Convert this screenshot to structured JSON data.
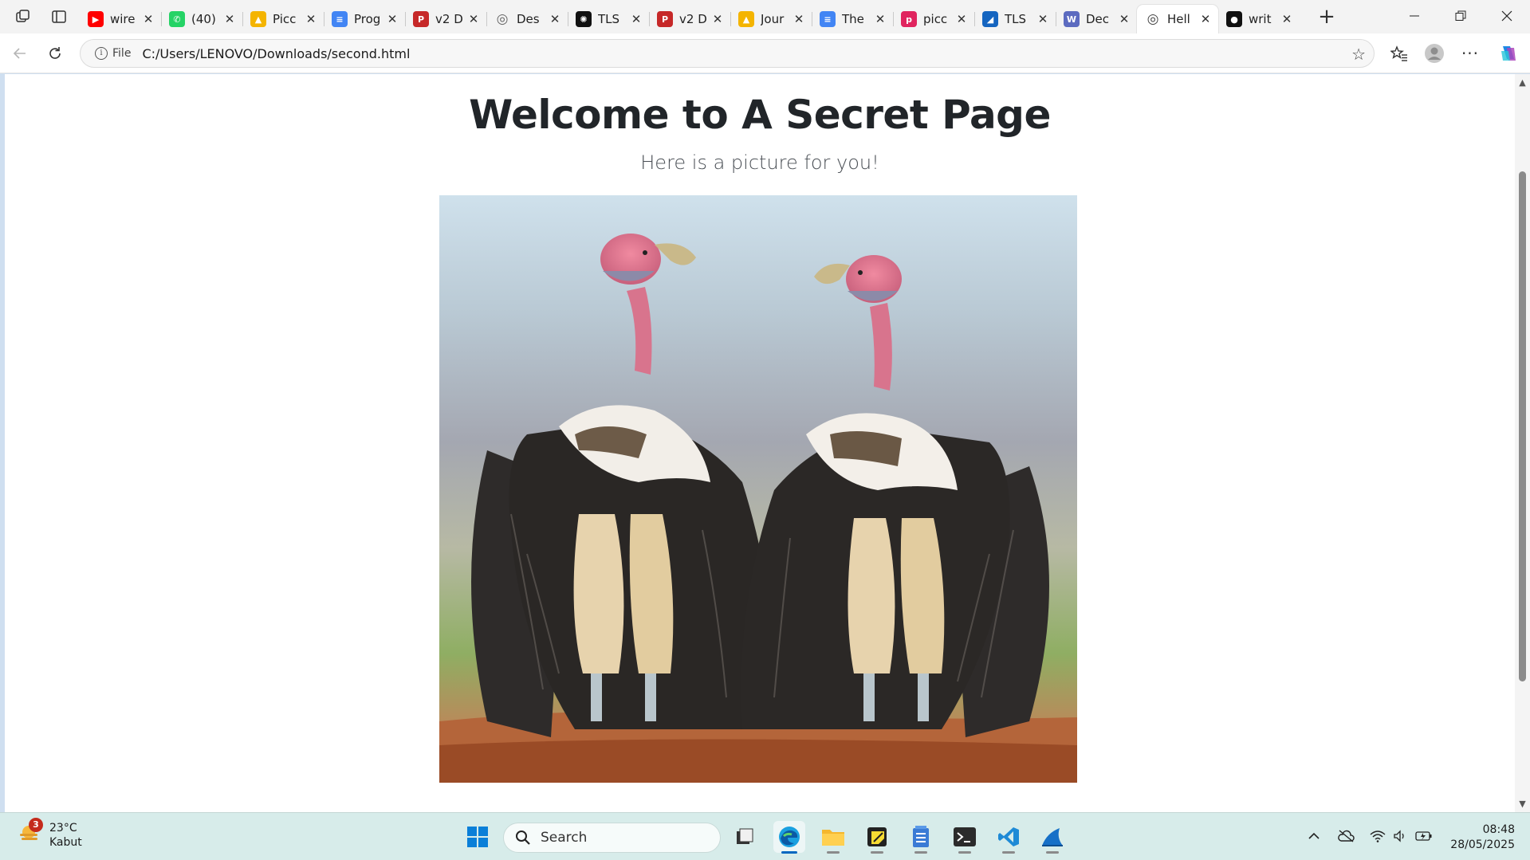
{
  "browser": {
    "tabs": [
      {
        "title": "wire",
        "icon": "youtube-icon",
        "color": "#ff0000",
        "active": false
      },
      {
        "title": "(40)",
        "icon": "whatsapp-icon",
        "color": "#25d366",
        "active": false
      },
      {
        "title": "Picc",
        "icon": "google-drive-icon",
        "color": "#f4b400",
        "active": false
      },
      {
        "title": "Prog",
        "icon": "google-docs-icon",
        "color": "#4285f4",
        "active": false
      },
      {
        "title": "v2 D",
        "icon": "pdf-icon",
        "color": "#c62828",
        "active": false
      },
      {
        "title": "Des",
        "icon": "globe-icon",
        "color": "#666666",
        "active": false
      },
      {
        "title": "TLS",
        "icon": "openai-icon",
        "color": "#111111",
        "active": false
      },
      {
        "title": "v2 D",
        "icon": "pdf-icon",
        "color": "#c62828",
        "active": false
      },
      {
        "title": "Jour",
        "icon": "google-drive-icon",
        "color": "#f4b400",
        "active": false
      },
      {
        "title": "The",
        "icon": "google-docs-icon",
        "color": "#4285f4",
        "active": false
      },
      {
        "title": "picc",
        "icon": "picsart-icon",
        "color": "#e0245e",
        "active": false
      },
      {
        "title": "TLS",
        "icon": "wireshark-icon",
        "color": "#1565c0",
        "active": false
      },
      {
        "title": "Dec",
        "icon": "wordpress-icon",
        "color": "#5c6bc0",
        "active": false
      },
      {
        "title": "Hell",
        "icon": "globe-icon",
        "color": "#444444",
        "active": true
      },
      {
        "title": "writ",
        "icon": "github-icon",
        "color": "#111111",
        "active": false
      }
    ],
    "address": {
      "scheme_label": "File",
      "url": "C:/Users/LENOVO/Downloads/second.html"
    }
  },
  "page": {
    "title": "Welcome to A Secret Page",
    "subtitle": "Here is a picture for you!",
    "image_subject": "two lappet-faced vultures"
  },
  "taskbar": {
    "weather": {
      "temp": "23°C",
      "condition": "Kabut",
      "badge": "3"
    },
    "search_label": "Search",
    "apps": [
      "task-view-icon",
      "edge-icon",
      "file-explorer-icon",
      "sticky-notes-icon",
      "notepad-icon",
      "terminal-icon",
      "vscode-icon",
      "wireshark-icon"
    ],
    "clock": {
      "time": "08:48",
      "date": "28/05/2025"
    }
  }
}
